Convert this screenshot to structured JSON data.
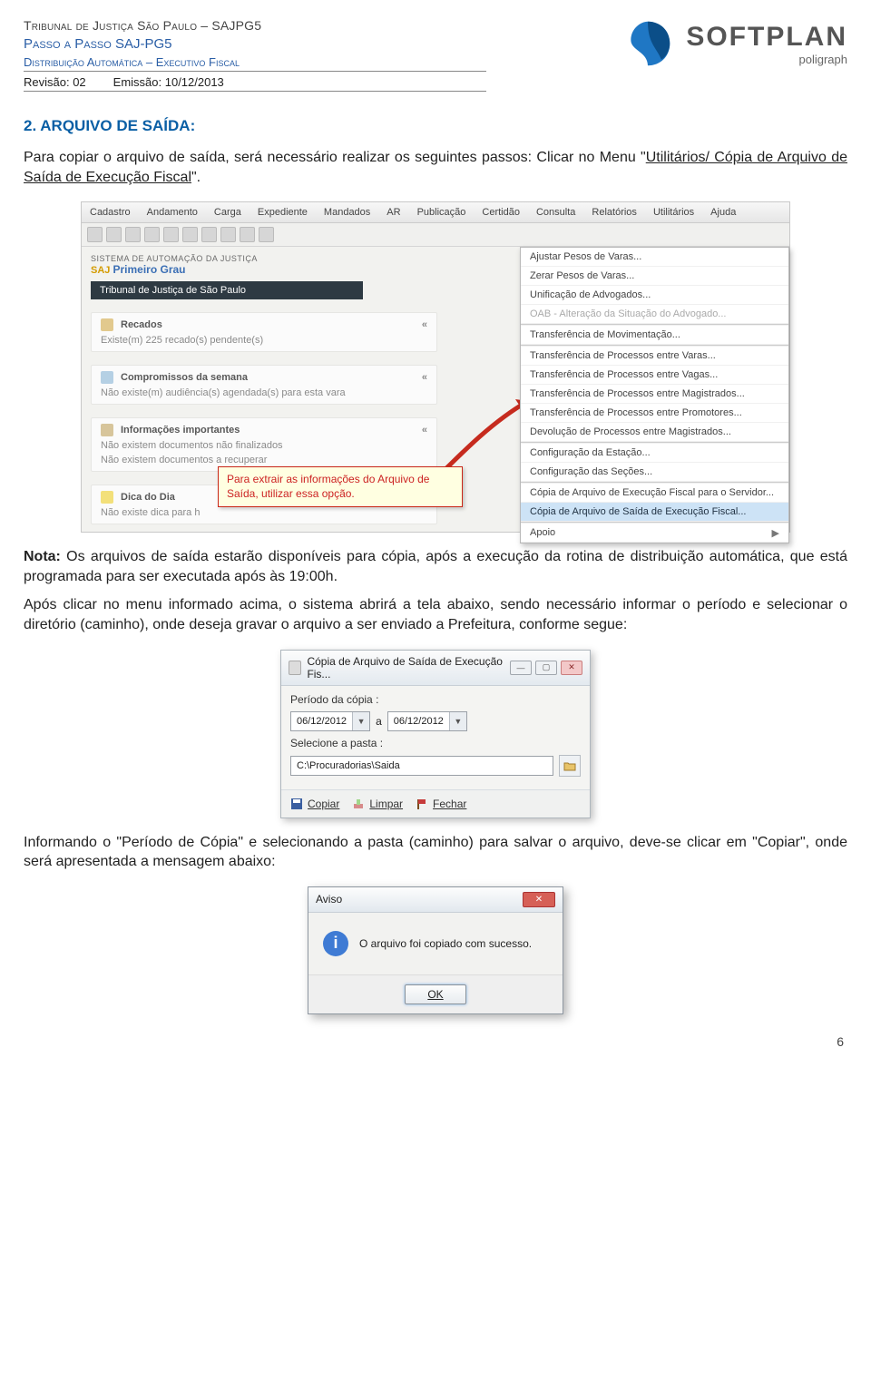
{
  "header": {
    "line1": "Tribunal de Justiça São Paulo – SAJPG5",
    "line2": "Passo a Passo SAJ-PG5",
    "line3": "Distribuição Automática – Executivo Fiscal",
    "revisao_label": "Revisão: 02",
    "emissao_label": "Emissão: 10/12/2013",
    "logo_big": "SOFTPLAN",
    "logo_small": "poligraph"
  },
  "section": {
    "title": "2. ARQUIVO DE SAÍDA:"
  },
  "p1_a": "Para copiar o arquivo de saída, será necessário realizar os seguintes passos: Clicar no Menu \"",
  "p1_u": "Utilitários/ Cópia de Arquivo de Saída de Execução Fiscal",
  "p1_b": "\".",
  "menubar": [
    "Cadastro",
    "Andamento",
    "Carga",
    "Expediente",
    "Mandados",
    "AR",
    "Publicação",
    "Certidão",
    "Consulta",
    "Relatórios",
    "Utilitários",
    "Ajuda"
  ],
  "saj": {
    "sys": "SISTEMA DE AUTOMAÇÃO DA JUSTIÇA",
    "pg": "Primeiro Grau",
    "tjsp": "Tribunal de Justiça de São Paulo"
  },
  "panels": {
    "recados": {
      "t": "Recados",
      "s": "Existe(m) 225 recado(s) pendente(s)"
    },
    "comp": {
      "t": "Compromissos da semana",
      "s": "Não existe(m) audiência(s) agendada(s) para esta vara"
    },
    "info": {
      "t": "Informações importantes",
      "s1": "Não existem documentos não finalizados",
      "s2": "Não existem documentos a recuperar"
    },
    "dica": {
      "t": "Dica do Dia",
      "s": "Não existe dica para h"
    }
  },
  "tooltip": "Para extrair as informações do Arquivo de Saída, utilizar essa opção.",
  "ddmenu": [
    {
      "t": "Ajustar Pesos de Varas...",
      "k": "mi"
    },
    {
      "t": "Zerar Pesos de Varas...",
      "k": "mi"
    },
    {
      "t": "Unificação de Advogados...",
      "k": "mi"
    },
    {
      "t": "OAB - Alteração da Situação do Advogado...",
      "k": "mi dis"
    },
    {
      "t": "",
      "k": "mi sep"
    },
    {
      "t": "Transferência de Movimentação...",
      "k": "mi"
    },
    {
      "t": "",
      "k": "mi sep"
    },
    {
      "t": "Transferência de Processos entre Varas...",
      "k": "mi"
    },
    {
      "t": "Transferência de Processos entre Vagas...",
      "k": "mi"
    },
    {
      "t": "Transferência de Processos entre Magistrados...",
      "k": "mi"
    },
    {
      "t": "Transferência de Processos entre Promotores...",
      "k": "mi"
    },
    {
      "t": "Devolução de Processos entre Magistrados...",
      "k": "mi"
    },
    {
      "t": "",
      "k": "mi sep"
    },
    {
      "t": "Configuração da Estação...",
      "k": "mi"
    },
    {
      "t": "Configuração das Seções...",
      "k": "mi"
    },
    {
      "t": "",
      "k": "mi sep"
    },
    {
      "t": "Cópia de Arquivo de Execução Fiscal para o Servidor...",
      "k": "mi"
    },
    {
      "t": "Cópia de Arquivo de Saída de Execução Fiscal...",
      "k": "mi hl"
    },
    {
      "t": "",
      "k": "mi sep"
    },
    {
      "t": "Apoio",
      "k": "mi",
      "tri": "▶"
    }
  ],
  "nota_label": "Nota:",
  "nota": " Os arquivos de saída estarão disponíveis para cópia, após a execução da rotina de distribuição automática, que está programada para ser executada após às 19:00h.",
  "p2": "Após clicar no menu informado acima, o sistema abrirá a tela abaixo, sendo necessário informar o período e selecionar o diretório (caminho), onde deseja gravar o arquivo a ser enviado a Prefeitura, conforme segue:",
  "dlg": {
    "title": "Cópia de Arquivo de Saída de Execução Fis...",
    "periodo_label": "Período da cópia :",
    "d1": "06/12/2012",
    "sep": "a",
    "d2": "06/12/2012",
    "pasta_label": "Selecione a pasta :",
    "path": "C:\\Procuradorias\\Saida",
    "btn_copiar": "Copiar",
    "btn_limpar": "Limpar",
    "btn_fechar": "Fechar"
  },
  "p3": "Informando o \"Período de Cópia\" e selecionando a pasta (caminho) para salvar o arquivo, deve-se clicar em \"Copiar\", onde será apresentada a mensagem abaixo:",
  "aviso": {
    "title": "Aviso",
    "msg": "O arquivo foi copiado com sucesso.",
    "ok": "OK"
  },
  "pagenum": "6"
}
